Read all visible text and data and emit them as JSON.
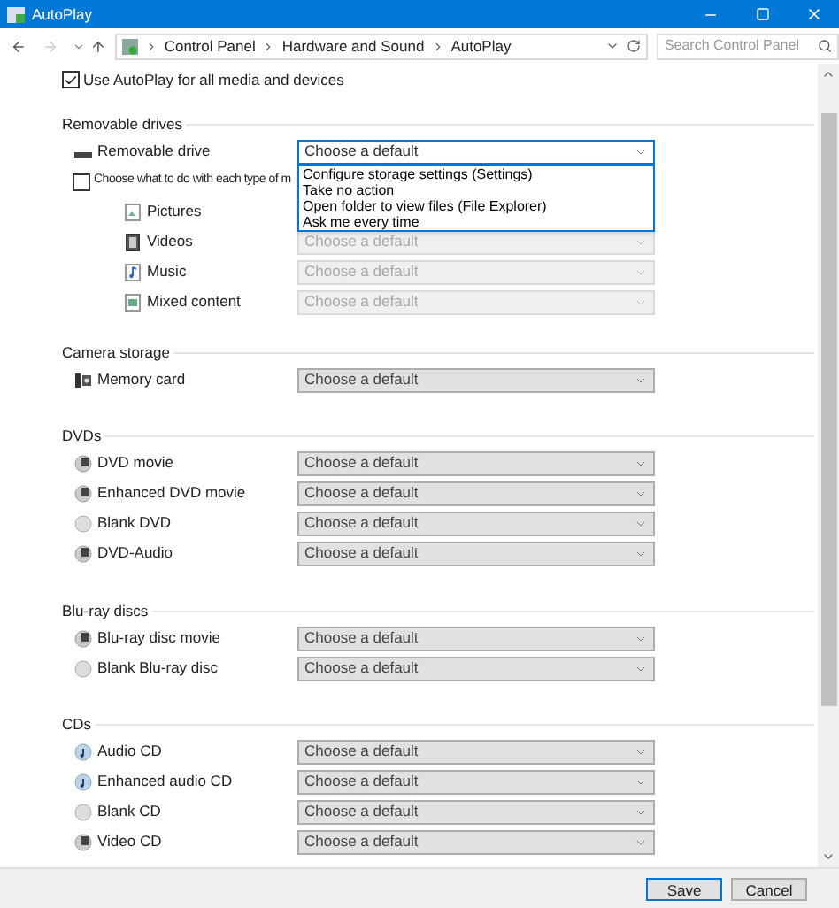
{
  "window": {
    "title": "AutoPlay"
  },
  "address_bar": {
    "breadcrumbs": [
      "Control Panel",
      "Hardware and Sound",
      "AutoPlay"
    ]
  },
  "search": {
    "placeholder": "Search Control Panel"
  },
  "autoplay": {
    "label": "Use AutoPlay for all media and devices",
    "checked": true
  },
  "sections": [
    {
      "title": "Removable drives",
      "items": [
        {
          "kind": "drive",
          "label": "Removable drive",
          "value": "Choose a default",
          "disabled": false,
          "expanded": true,
          "options": [
            "Configure storage settings (Settings)",
            "Take no action",
            "Open folder to view files (File Explorer)",
            "Ask me every time"
          ]
        },
        {
          "kind": "checkbox",
          "label": "Choose what to do with each type of m",
          "checked": false,
          "children": [
            {
              "kind": "pictures",
              "label": "Pictures"
            },
            {
              "kind": "video",
              "label": "Videos",
              "value": "Choose a default",
              "disabled": true,
              "expanded": false
            },
            {
              "kind": "music",
              "label": "Music",
              "value": "Choose a default",
              "disabled": true,
              "expanded": false
            },
            {
              "kind": "mixed",
              "label": "Mixed content",
              "value": "Choose a default",
              "disabled": true,
              "expanded": false
            }
          ]
        }
      ]
    },
    {
      "title": "Camera storage",
      "items": [
        {
          "kind": "card",
          "label": "Memory card",
          "value": "Choose a default",
          "disabled": false,
          "expanded": false
        }
      ]
    },
    {
      "title": "DVDs",
      "items": [
        {
          "kind": "disc",
          "label": "DVD movie",
          "value": "Choose a default",
          "disabled": false,
          "expanded": false
        },
        {
          "kind": "disc",
          "label": "Enhanced DVD movie",
          "value": "Choose a default",
          "disabled": false,
          "expanded": false
        },
        {
          "kind": "blank",
          "label": "Blank DVD",
          "value": "Choose a default",
          "disabled": false,
          "expanded": false
        },
        {
          "kind": "disc",
          "label": "DVD-Audio",
          "value": "Choose a default",
          "disabled": false,
          "expanded": false
        }
      ]
    },
    {
      "title": "Blu-ray discs",
      "items": [
        {
          "kind": "disc",
          "label": "Blu-ray disc movie",
          "value": "Choose a default",
          "disabled": false,
          "expanded": false
        },
        {
          "kind": "blank",
          "label": "Blank Blu-ray disc",
          "value": "Choose a default",
          "disabled": false,
          "expanded": false
        }
      ]
    },
    {
      "title": "CDs",
      "items": [
        {
          "kind": "audio",
          "label": "Audio CD",
          "value": "Choose a default",
          "disabled": false,
          "expanded": false
        },
        {
          "kind": "audio",
          "label": "Enhanced audio CD",
          "value": "Choose a default",
          "disabled": false,
          "expanded": false
        },
        {
          "kind": "blank",
          "label": "Blank CD",
          "value": "Choose a default",
          "disabled": false,
          "expanded": false
        },
        {
          "kind": "disc",
          "label": "Video CD",
          "value": "Choose a default",
          "disabled": false,
          "expanded": false
        }
      ]
    }
  ],
  "buttons": [
    {
      "label": "Save",
      "default": true
    },
    {
      "label": "Cancel",
      "default": false
    }
  ]
}
